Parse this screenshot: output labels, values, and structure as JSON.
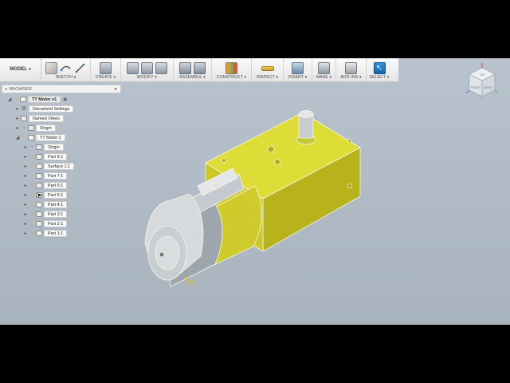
{
  "toolbar": {
    "workspace": "MODEL",
    "groups": [
      {
        "label": "SKETCH ▾"
      },
      {
        "label": "CREATE ▾"
      },
      {
        "label": "MODIFY ▾"
      },
      {
        "label": "ASSEMBLE ▾"
      },
      {
        "label": "CONSTRUCT ▾"
      },
      {
        "label": "INSPECT ▾"
      },
      {
        "label": "INSERT ▾"
      },
      {
        "label": "MAKE ▾"
      },
      {
        "label": "ADD-INS ▾"
      },
      {
        "label": "SELECT ▾"
      }
    ]
  },
  "browser": {
    "title": "BROWSER",
    "root": "TT Motor v1",
    "items": [
      {
        "label": "Document Settings"
      },
      {
        "label": "Named Views"
      },
      {
        "label": "Origin"
      },
      {
        "label": "TT Motor:1"
      },
      {
        "label": "Origin"
      },
      {
        "label": "Part 8:1"
      },
      {
        "label": "Surface 1:1"
      },
      {
        "label": "Part 7:1"
      },
      {
        "label": "Part 6:1"
      },
      {
        "label": "Part 5:1"
      },
      {
        "label": "Part 4:1"
      },
      {
        "label": "Part 3:1"
      },
      {
        "label": "Part 2:1"
      },
      {
        "label": "Part 1:1"
      }
    ]
  },
  "viewcube": {
    "front": "FRONT",
    "right": "RIGHT",
    "top": "TOP"
  },
  "colors": {
    "accent": "#1e78c2",
    "body_yellow": "#d8d62c",
    "gear_gray": "#c9ced3",
    "canvas": "#b4bec8"
  },
  "icons": [
    "lightbulb-icon",
    "gear-icon",
    "folder-icon",
    "component-icon",
    "pin-icon",
    "select-arrow-icon"
  ]
}
